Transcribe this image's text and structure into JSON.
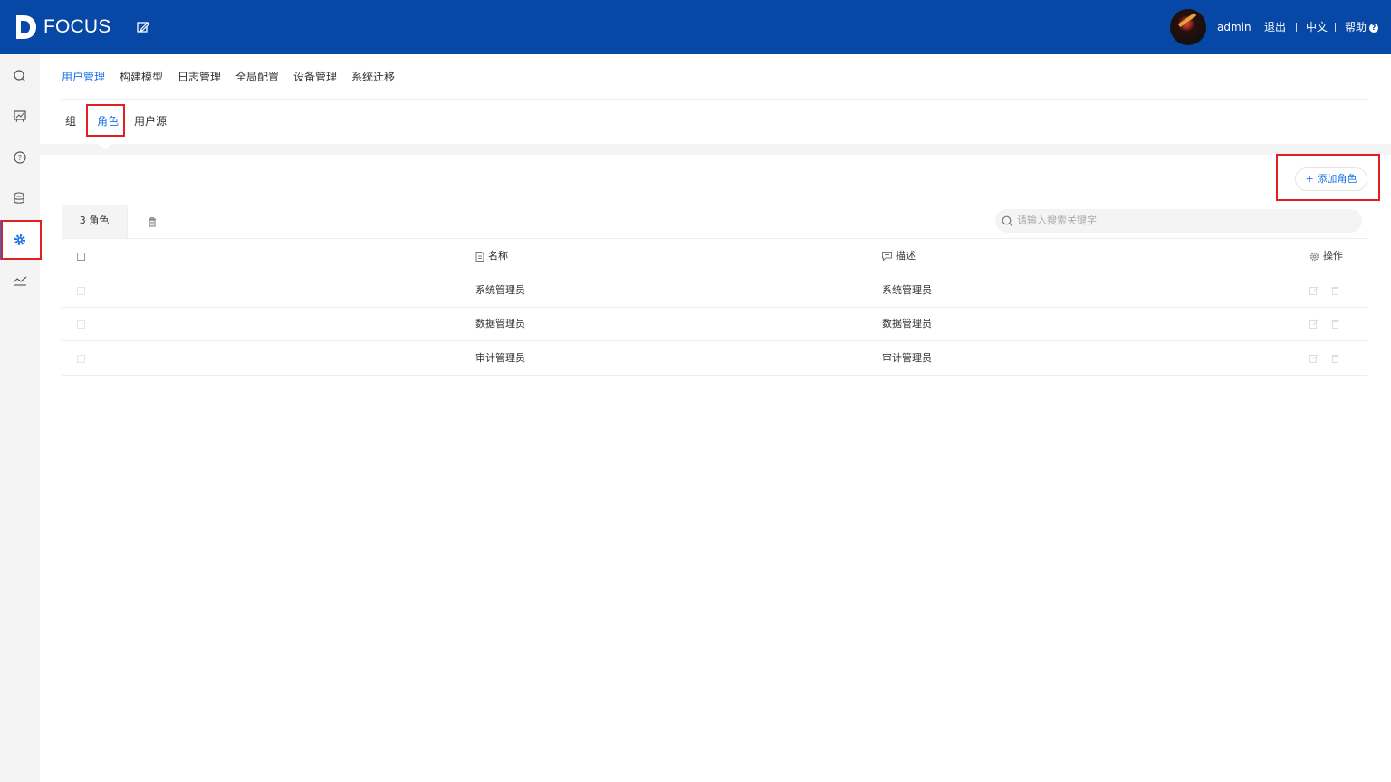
{
  "header": {
    "brand": "FOCUS",
    "user": "admin",
    "logout": "退出",
    "language": "中文",
    "help": "帮助"
  },
  "sidebar": {
    "items": [
      "search-icon",
      "presentation-icon",
      "question-icon",
      "database-icon",
      "settings-icon",
      "trend-icon"
    ],
    "active": "settings-icon"
  },
  "main_tabs": [
    "用户管理",
    "构建模型",
    "日志管理",
    "全局配置",
    "设备管理",
    "系统迁移"
  ],
  "sub_tabs": [
    "组",
    "角色",
    "用户源"
  ],
  "toolbar": {
    "add_label": "添加角色"
  },
  "list": {
    "count_label": "3 角色",
    "search_placeholder": "请输入搜索关键字"
  },
  "table": {
    "columns": [
      "名称",
      "描述",
      "操作"
    ],
    "rows": [
      {
        "name": "系统管理员",
        "desc": "系统管理员"
      },
      {
        "name": "数据管理员",
        "desc": "数据管理员"
      },
      {
        "name": "审计管理员",
        "desc": "审计管理员"
      }
    ]
  },
  "colors": {
    "header_bg": "#0747a6",
    "accent": "#1a73e8",
    "highlight_box": "#e02020"
  }
}
